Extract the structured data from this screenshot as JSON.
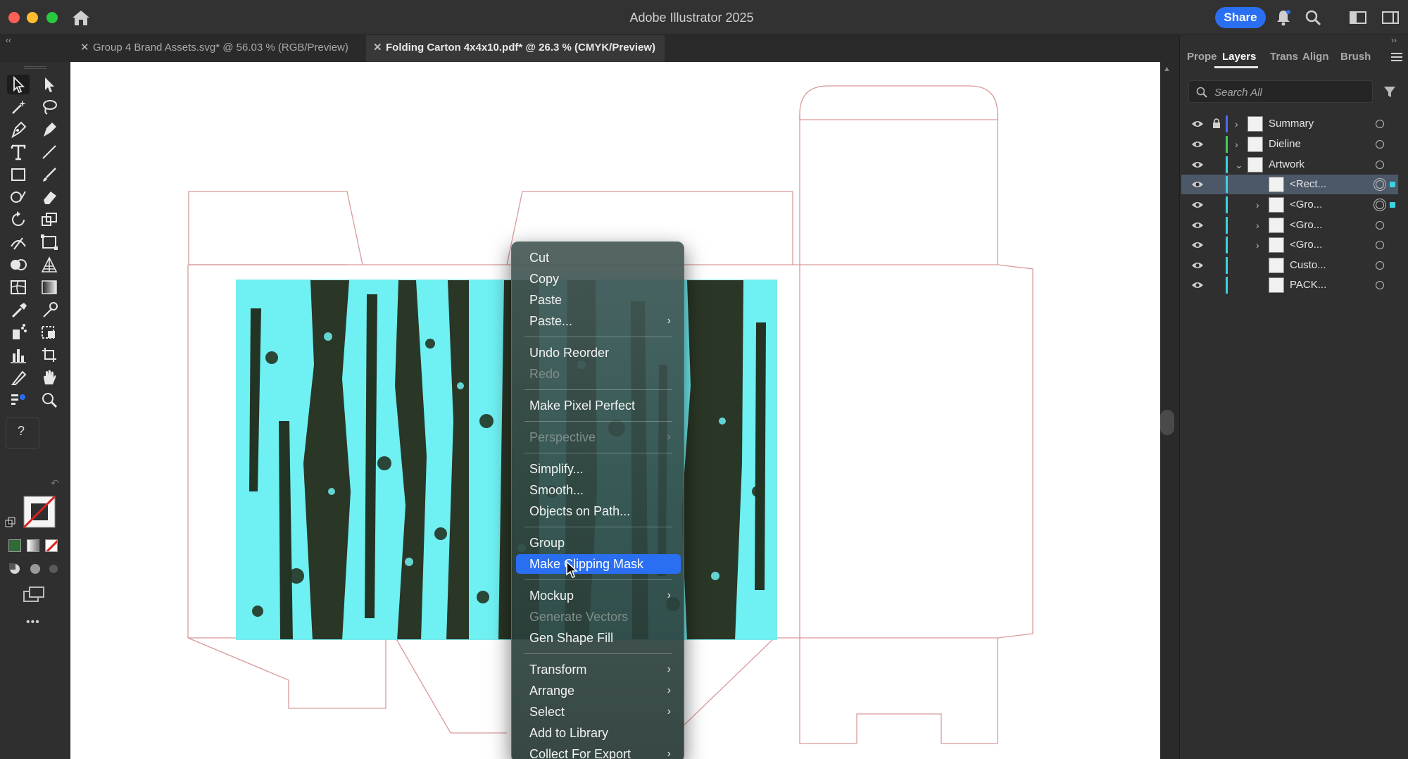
{
  "app": {
    "title": "Adobe Illustrator 2025",
    "share_label": "Share"
  },
  "tabs": [
    {
      "label": "Group 4 Brand Assets.svg* @ 56.03 % (RGB/Preview)",
      "active": false
    },
    {
      "label": "Folding Carton 4x4x10.pdf* @ 26.3 % (CMYK/Preview)",
      "active": true
    }
  ],
  "toolbar": {
    "more_label": "•••",
    "unknown_label": "?"
  },
  "context_menu": {
    "items": [
      {
        "label": "Cut"
      },
      {
        "label": "Copy"
      },
      {
        "label": "Paste"
      },
      {
        "label": "Paste...",
        "submenu": true
      },
      {
        "label": "Undo Reorder"
      },
      {
        "label": "Redo",
        "disabled": true
      },
      {
        "label": "Make Pixel Perfect"
      },
      {
        "label": "Perspective",
        "submenu": true,
        "disabled": true
      },
      {
        "label": "Simplify..."
      },
      {
        "label": "Smooth..."
      },
      {
        "label": "Objects on Path..."
      },
      {
        "label": "Group"
      },
      {
        "label": "Make Clipping Mask",
        "highlighted": true
      },
      {
        "label": "Mockup",
        "submenu": true
      },
      {
        "label": "Generate Vectors",
        "disabled": true
      },
      {
        "label": "Gen Shape Fill"
      },
      {
        "label": "Transform",
        "submenu": true
      },
      {
        "label": "Arrange",
        "submenu": true
      },
      {
        "label": "Select",
        "submenu": true
      },
      {
        "label": "Add to Library"
      },
      {
        "label": "Collect For Export",
        "submenu": true
      }
    ]
  },
  "panel": {
    "tabs": [
      "Prope",
      "Layers",
      "Trans",
      "Align",
      "Brush"
    ],
    "active_tab": "Layers",
    "search_placeholder": "Search All",
    "layers": [
      {
        "name": "Summary",
        "color": "#4a6cf0"
      },
      {
        "name": "Dieline",
        "color": "#3fce5a"
      },
      {
        "name": "Artwork",
        "color": "#3cd3e0",
        "expanded": true
      },
      {
        "name": "<Rect...",
        "color": "#3cd3e0",
        "selected": true
      },
      {
        "name": "<Gro...",
        "color": "#3cd3e0"
      },
      {
        "name": "<Gro...",
        "color": "#3cd3e0"
      },
      {
        "name": "<Gro...",
        "color": "#3cd3e0"
      },
      {
        "name": "Custo...",
        "color": "#3cd3e0"
      },
      {
        "name": "PACK...",
        "color": "#3cd3e0"
      }
    ]
  },
  "colors": {
    "accent": "#2a6ff2",
    "selection": "#3cd3e0",
    "dieline": "#d99a9a",
    "forest_dark": "#233424",
    "forest_light": "#6ff0f2"
  }
}
